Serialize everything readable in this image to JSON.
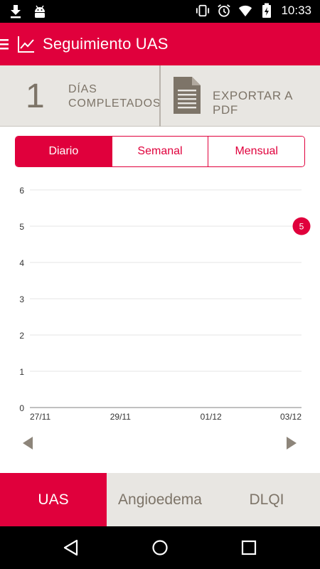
{
  "status_bar": {
    "time": "10:33",
    "left_icons": [
      "download-icon",
      "android-icon"
    ],
    "right_icons": [
      "vibrate-icon",
      "alarm-icon",
      "wifi-icon",
      "battery-charging-icon"
    ]
  },
  "app_bar": {
    "title": "Seguimiento UAS",
    "icon": "chart-line-icon",
    "background": "#e0003c"
  },
  "summary": {
    "count": "1",
    "days_line1": "DÍAS",
    "days_line2": "COMPLETADOS",
    "export_label": "EXPORTAR A PDF",
    "export_icon": "document-icon"
  },
  "period_tabs": [
    {
      "label": "Diario",
      "active": true
    },
    {
      "label": "Semanal",
      "active": false
    },
    {
      "label": "Mensual",
      "active": false
    }
  ],
  "chart_data": {
    "type": "scatter",
    "x_tick_labels": [
      "27/11",
      "29/11",
      "01/12",
      "03/12"
    ],
    "y_ticks": [
      0,
      1,
      2,
      3,
      4,
      5,
      6
    ],
    "ylim": [
      0,
      6
    ],
    "grid": true,
    "points": [
      {
        "x": "03/12",
        "y": 5,
        "label": "5"
      }
    ],
    "point_color": "#e0003c"
  },
  "pager": {
    "prev_icon": "chevron-left-icon",
    "next_icon": "chevron-right-icon"
  },
  "bottom_tabs": [
    {
      "label": "UAS",
      "active": true
    },
    {
      "label": "Angioedema",
      "active": false
    },
    {
      "label": "DLQI",
      "active": false
    }
  ],
  "nav_bar": {
    "icons": [
      "back-icon",
      "home-icon",
      "recents-icon"
    ]
  }
}
